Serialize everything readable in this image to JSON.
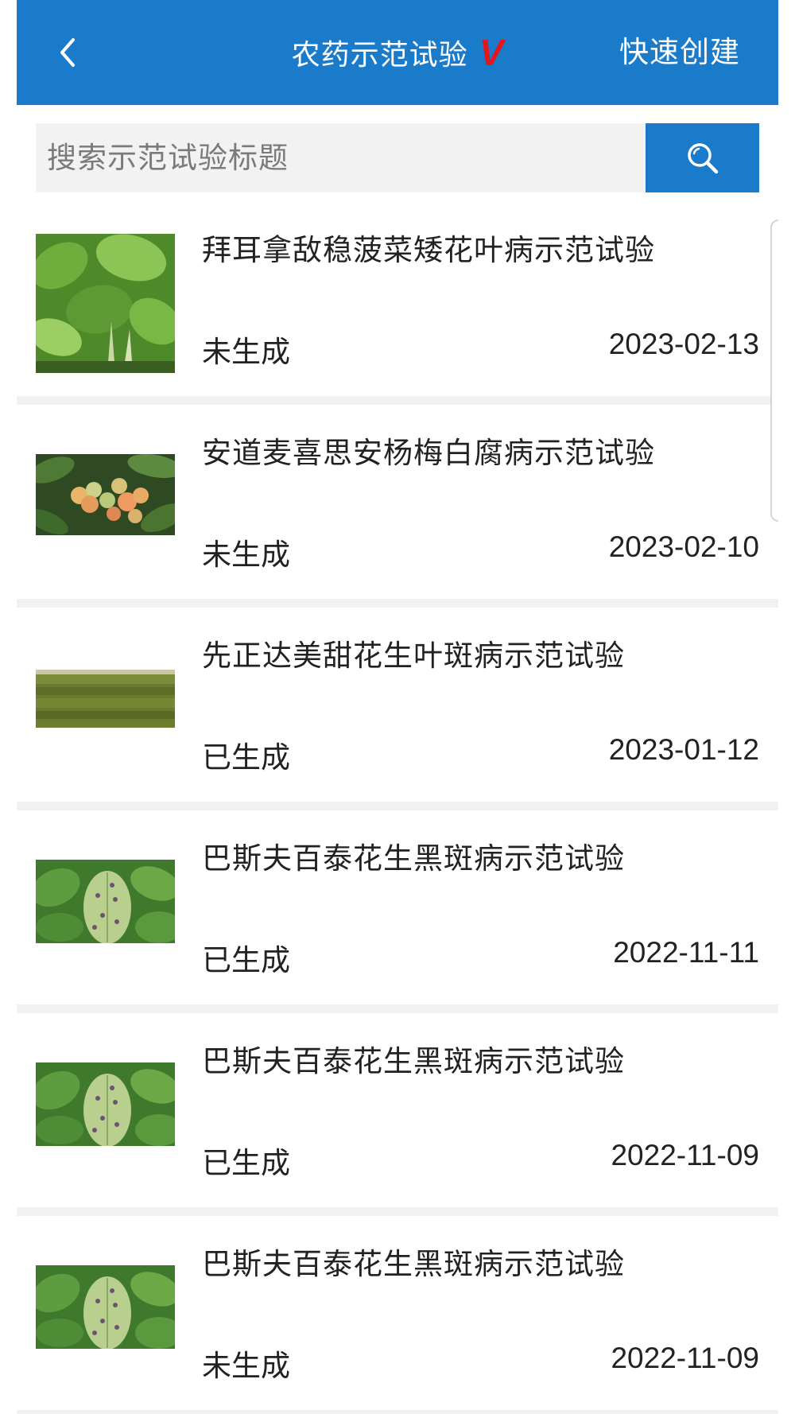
{
  "header": {
    "title": "农药示范试验",
    "title_badge": "V",
    "quick_create_label": "快速创建"
  },
  "search": {
    "placeholder": "搜索示范试验标题"
  },
  "colors": {
    "primary": "#1a7bcb",
    "badge": "#e3161e",
    "background": "#f1f1f1"
  },
  "items": [
    {
      "title": "拜耳拿敌稳菠菜矮花叶病示范试验",
      "status": "未生成",
      "date": "2023-02-13",
      "image": "spinach-photo"
    },
    {
      "title": "安道麦喜思安杨梅白腐病示范试验",
      "status": "未生成",
      "date": "2023-02-10",
      "image": "bayberry-photo"
    },
    {
      "title": "先正达美甜花生叶斑病示范试验",
      "status": "已生成",
      "date": "2023-01-12",
      "image": "field-photo"
    },
    {
      "title": "巴斯夫百泰花生黑斑病示范试验",
      "status": "已生成",
      "date": "2022-11-11",
      "image": "peanut-leaf-photo"
    },
    {
      "title": "巴斯夫百泰花生黑斑病示范试验",
      "status": "已生成",
      "date": "2022-11-09",
      "image": "peanut-leaf-photo"
    },
    {
      "title": "巴斯夫百泰花生黑斑病示范试验",
      "status": "未生成",
      "date": "2022-11-09",
      "image": "peanut-leaf-photo"
    }
  ]
}
